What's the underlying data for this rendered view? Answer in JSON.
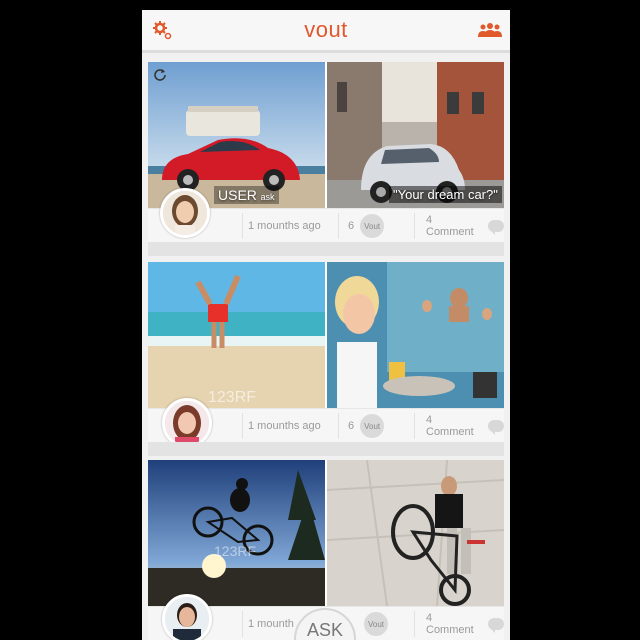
{
  "app": {
    "title": "vout"
  },
  "header": {
    "left_icon": "gear-icon",
    "right_icon": "group-icon"
  },
  "posts": [
    {
      "author_label": "USER",
      "author_suffix": "ask",
      "question": "\"Your dream car?\"",
      "time": "1 mounths ago",
      "vote_count": "6",
      "vote_label": "Vout",
      "comments": "4 Comment"
    },
    {
      "time": "1 mounths ago",
      "vote_count": "6",
      "vote_label": "Vout",
      "comments": "4 Comment"
    },
    {
      "time": "1 mounth",
      "vote_label": "Vout",
      "comments": "4 Comment"
    }
  ],
  "ask_button": {
    "label": "ASK"
  },
  "watermarks": [
    "123RF",
    "123RF"
  ],
  "colors": {
    "accent": "#e0582b",
    "background": "#000000"
  }
}
